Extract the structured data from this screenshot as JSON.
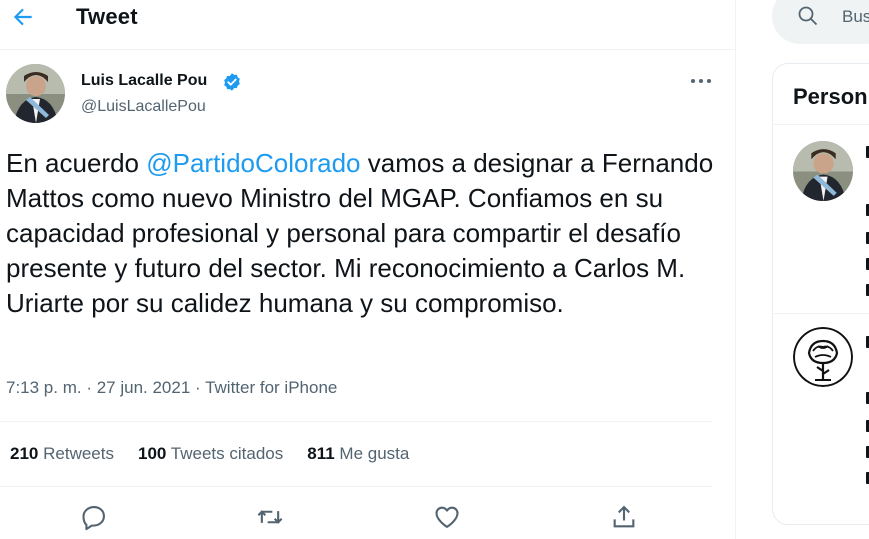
{
  "header": {
    "title": "Tweet"
  },
  "tweet": {
    "author_name": "Luis Lacalle Pou",
    "author_handle": "@LuisLacallePou",
    "text_before": "En acuerdo ",
    "mention": "@PartidoColorado",
    "text_after": " vamos a designar a Fernando Mattos como nuevo Ministro del MGAP. Confiamos en su capacidad profesional y personal para compartir el desafío presente y futuro del sector. Mi reconocimiento a Carlos M. Uriarte por su calidez humana y su compromiso.",
    "meta": "7:13 p. m. · 27 jun. 2021 · Twitter for iPhone"
  },
  "stats": {
    "retweets_count": "210",
    "retweets_label": "Retweets",
    "quotes_count": "100",
    "quotes_label": "Tweets citados",
    "likes_count": "811",
    "likes_label": "Me gusta"
  },
  "sidebar": {
    "search_placeholder": "Bus",
    "section_title": "Person"
  },
  "icons": {
    "back": "arrow-left-icon",
    "verified": "verified-badge-icon",
    "more": "more-horizontal-icon",
    "reply": "reply-icon",
    "retweet": "retweet-icon",
    "like": "heart-icon",
    "share": "share-icon",
    "search": "search-icon"
  },
  "colors": {
    "accent": "#1d9bf0",
    "muted": "#536471",
    "text": "#0f1419"
  }
}
